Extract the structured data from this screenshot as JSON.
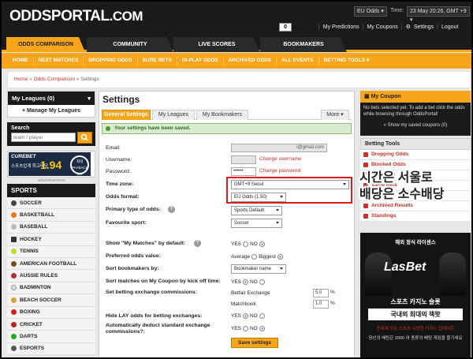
{
  "header": {
    "logo_main": "ODDSPORTAL",
    "logo_suffix": ".COM",
    "odds_format_select": "EU Odds",
    "time_label": "Time:",
    "time_value": "23 May 20:26, GMT +9",
    "coupon_count": "0",
    "user_links": [
      "My Predictions",
      "My Coupons",
      "Settings",
      "Logout"
    ]
  },
  "nav": {
    "tabs": [
      "ODDS COMPARISON",
      "COMMUNITY",
      "LIVE SCORES",
      "BOOKMAKERS"
    ],
    "sub_items": [
      "HOME",
      "NEXT MATCHES",
      "DROPPING ODDS",
      "SURE BETS",
      "IN-PLAY ODDS",
      "ARCHIVED ODDS",
      "ALL EVENTS",
      "BETTING TOOLS ▾"
    ]
  },
  "breadcrumb": {
    "home": "Home",
    "sep": "»",
    "section": "Odds Comparison",
    "current": "Settings"
  },
  "left": {
    "my_leagues_title": "My Leagues (0)",
    "manage_label": "+ Manage My Leagues",
    "search_title": "Search",
    "search_placeholder": "team / player",
    "ad": {
      "brand": "CUREBET",
      "tagline": "스포츠업계 최고배당",
      "value": "1.94",
      "badge": "최대 PAYBACK 5%"
    },
    "ad_label": "advertisement",
    "sports_title": "SPORTS",
    "sports": [
      "SOCCER",
      "BASKETBALL",
      "BASEBALL",
      "HOCKEY",
      "TENNIS",
      "AMERICAN FOOTBALL",
      "AUSSIE RULES",
      "BADMINTON",
      "BEACH SOCCER",
      "BOXING",
      "CRICKET",
      "DARTS",
      "ESPORTS"
    ]
  },
  "main": {
    "title": "Settings",
    "tabs": [
      "General Settings",
      "My Leagues",
      "My Bookmakers",
      "More"
    ],
    "success_msg": "Your settings have been saved.",
    "fields": {
      "email_label": "Email:",
      "email_value": "i@gmail.com",
      "username_label": "Username:",
      "username_link": "Change username",
      "password_label": "Password:",
      "password_value": "••••••",
      "password_link": "Change password",
      "timezone_label": "Time zone:",
      "timezone_value": "GMT+9 Seoul",
      "oddsformat_label": "Odds format:",
      "oddsformat_value": "EU Odds (1.50)",
      "primary_label": "Primary type of odds:",
      "primary_value": "Sports Default",
      "fav_sport_label": "Favourite sport:",
      "fav_sport_value": "Soccer",
      "show_matches_label": "Show \"My Matches\" by default:",
      "pref_odds_label": "Preferred odds value:",
      "pref_odds_avg": "Average",
      "pref_odds_big": "Biggest",
      "sort_book_label": "Sort bookmakers by:",
      "sort_book_value": "Bookmaker name",
      "sort_coupon_label": "Sort matches on My Coupon by kick off time:",
      "commission_label": "Set betting exchange commissions:",
      "betfair_label": "Betfair Exchange",
      "betfair_value": "5.0",
      "matchbook_label": "Matchbook",
      "matchbook_value": "1.0",
      "hide_lay_label": "Hide LAY odds for betting exchanges:",
      "deduct_label": "Automatically deduct standard exchange commissions?:",
      "yes": "YES",
      "no": "NO",
      "pct": "%"
    },
    "save_label": "Save settings"
  },
  "overlay_text": [
    "시간은 서울로",
    "배당은 소수배당"
  ],
  "right": {
    "coupon_title": "My Coupon",
    "coupon_body": "No bets selected yet. To add a bet click the odds while browsing through OddsPortal!",
    "coupon_link": "» Show my saved coupons (0)",
    "tools_title": "Betting Tools",
    "tools": [
      "Dropping Odds",
      "Blocked Odds",
      "Sure Bets",
      "Value Bets",
      "Big Bets",
      "Archived Results",
      "Standings"
    ],
    "ad": {
      "line1": "해외 정식 라이센스",
      "brand": "LasBet",
      "line2": "스포츠 카지노 슬롯",
      "line3": "국내외 최대의 잭팟",
      "line4": "전세계 모든 스포츠 다양한 카지노 업데이트",
      "line5": "당신의 배팅은 2000 여 종류의 배팅 게임을 즐기세요"
    }
  },
  "colors": {
    "accent": "#f7a51a",
    "header_bg": "#1a1a1a",
    "link_red": "#c8302a",
    "annotation_red": "#e01a1a"
  }
}
